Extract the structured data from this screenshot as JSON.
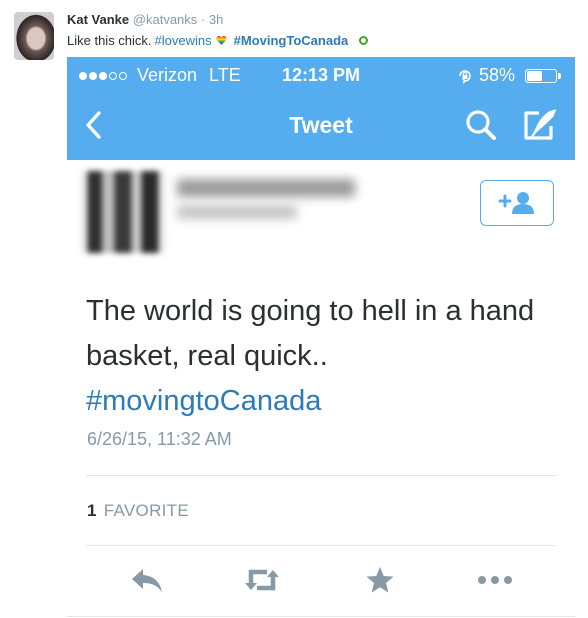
{
  "outer_tweet": {
    "name": "Kat Vanke",
    "handle": "@katvanks",
    "separator": " · ",
    "time": "3h",
    "text_prefix": "Like this chick.",
    "hashtag1": "#lovewins",
    "hashtag2": "#MovingToCanada",
    "emoji_heart_colors": [
      "#e81c1c",
      "#f7941d",
      "#ffe600",
      "#39b54a",
      "#1e76d2",
      "#8e2cc0"
    ]
  },
  "phone": {
    "carrier": "Verizon",
    "network": "LTE",
    "clock": "12:13 PM",
    "battery_text": "58%",
    "battery_level": 0.58,
    "nav_title": "Tweet",
    "accent": "#55acee"
  },
  "embedded_tweet": {
    "text": "The world is going to hell in a hand basket, real quick..",
    "hashtag": "#movingtoCanada",
    "date": "6/26/15, 11:32 AM",
    "favorite_count": "1",
    "favorite_label": "FAVORITE"
  },
  "icons": [
    "reply-icon",
    "retweet-icon",
    "favorite-icon",
    "more-icon",
    "search-icon",
    "compose-icon",
    "back-icon",
    "follow-icon",
    "orientation-lock-icon"
  ]
}
